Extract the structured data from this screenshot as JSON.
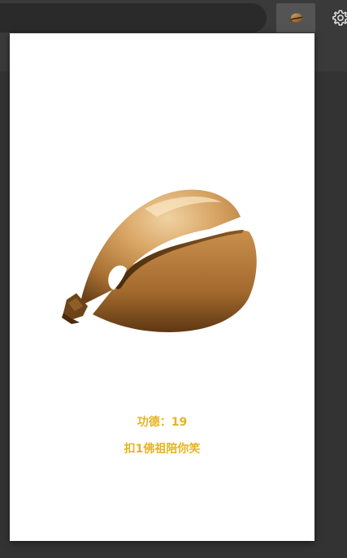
{
  "popup": {
    "merit_label": "功德：",
    "merit_count": "19",
    "blessing": "扣1佛祖陪你笑"
  },
  "colors": {
    "accent_text": "#e6b422",
    "wood_light": "#e3bd88",
    "wood_dark": "#8a5a24"
  },
  "icons": {
    "extension": "wooden-fish-icon",
    "settings": "gear-icon"
  }
}
